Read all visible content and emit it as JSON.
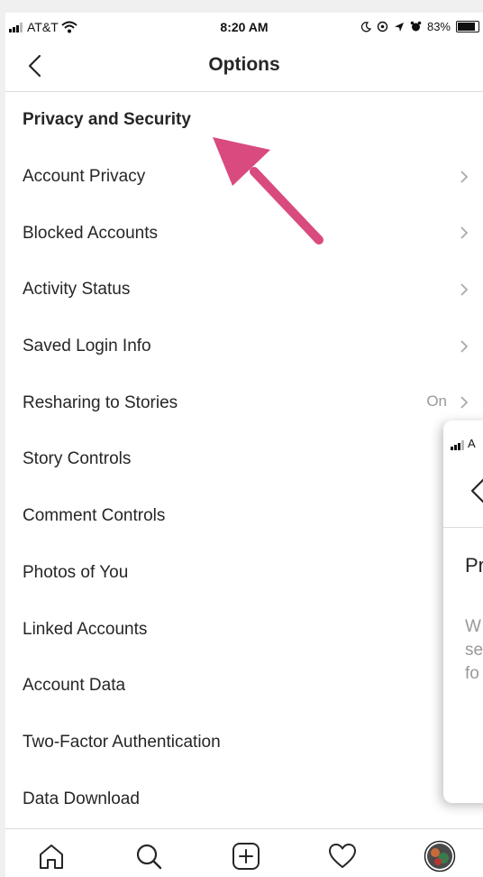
{
  "status_bar": {
    "carrier": "AT&T",
    "time": "8:20 AM",
    "battery": "83%"
  },
  "header": {
    "title": "Options"
  },
  "sections": {
    "privacy_security": "Privacy and Security"
  },
  "items": [
    {
      "label": "Account Privacy",
      "chevron": true
    },
    {
      "label": "Blocked Accounts",
      "chevron": true
    },
    {
      "label": "Activity Status",
      "chevron": true
    },
    {
      "label": "Saved Login Info",
      "chevron": true
    },
    {
      "label": "Resharing to Stories",
      "value": "On",
      "chevron": true
    },
    {
      "label": "Story Controls"
    },
    {
      "label": "Comment Controls"
    },
    {
      "label": "Photos of You"
    },
    {
      "label": "Linked Accounts"
    },
    {
      "label": "Account Data"
    },
    {
      "label": "Two-Factor Authentication"
    },
    {
      "label": "Data Download"
    }
  ],
  "overlay": {
    "carrier_partial": "A",
    "title_partial": "Pr",
    "description_partial": "W\nse\nfo"
  },
  "tabbar": [
    "home-icon",
    "search-icon",
    "add-post-icon",
    "activity-heart-icon",
    "profile-avatar-icon"
  ],
  "colors": {
    "annotation_arrow": "#d94a7f",
    "divider": "#dbdbdb",
    "secondary_text": "#999999"
  }
}
